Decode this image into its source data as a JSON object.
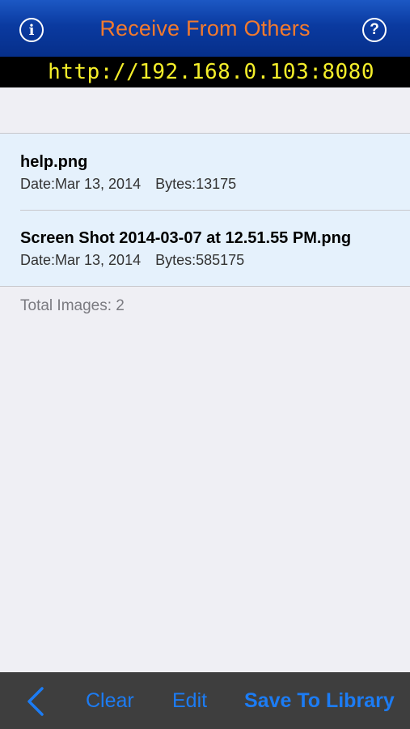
{
  "navbar": {
    "title": "Receive From Others",
    "info_glyph": "i",
    "help_glyph": "?"
  },
  "server": {
    "url": "http://192.168.0.103:8080"
  },
  "files": [
    {
      "name": "help.png",
      "date": "Date:Mar 13, 2014",
      "bytes": "Bytes:13175"
    },
    {
      "name": "Screen Shot 2014-03-07 at 12.51.55 PM.png",
      "date": "Date:Mar 13, 2014",
      "bytes": "Bytes:585175"
    }
  ],
  "summary": {
    "total_label": "Total Images: 2"
  },
  "toolbar": {
    "back_icon": "chevron-left-icon",
    "clear_label": "Clear",
    "edit_label": "Edit",
    "save_label": "Save To Library"
  },
  "colors": {
    "nav_title": "#f27a2e",
    "url_text": "#f4ee2a",
    "toolbar_tint": "#1c7cf4",
    "list_bg": "#e5f1fc"
  }
}
